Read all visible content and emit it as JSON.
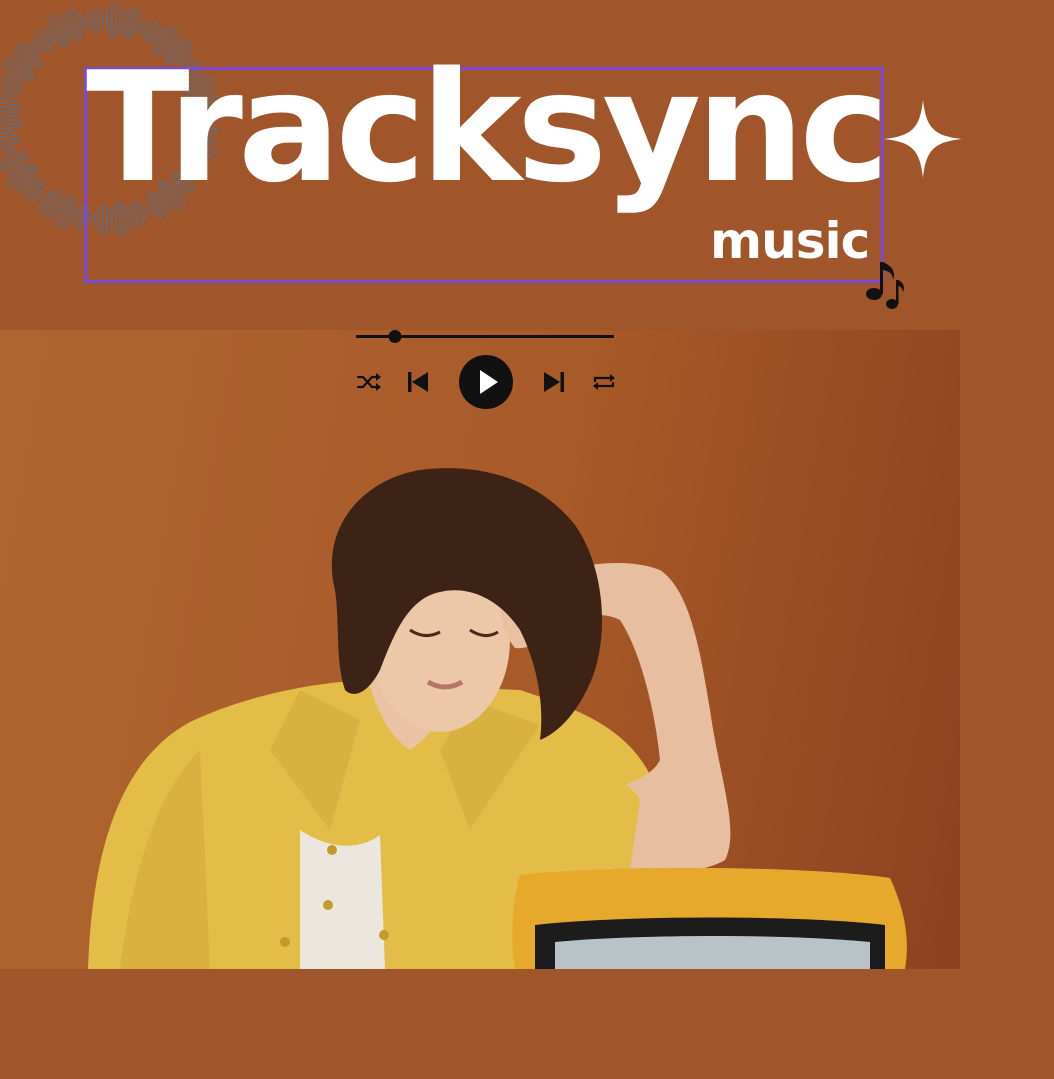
{
  "brand": {
    "title": "Tracksync",
    "subtitle": "music"
  },
  "player": {
    "progress": 0.15,
    "controls": [
      "shuffle",
      "previous",
      "play",
      "next",
      "repeat"
    ]
  },
  "colors": {
    "background": "#a0562a",
    "frame": "#7b4ad9",
    "title": "#ffffff",
    "controls": "#111111",
    "shirt": "#e6c04a",
    "tv": "#e7a92b"
  }
}
